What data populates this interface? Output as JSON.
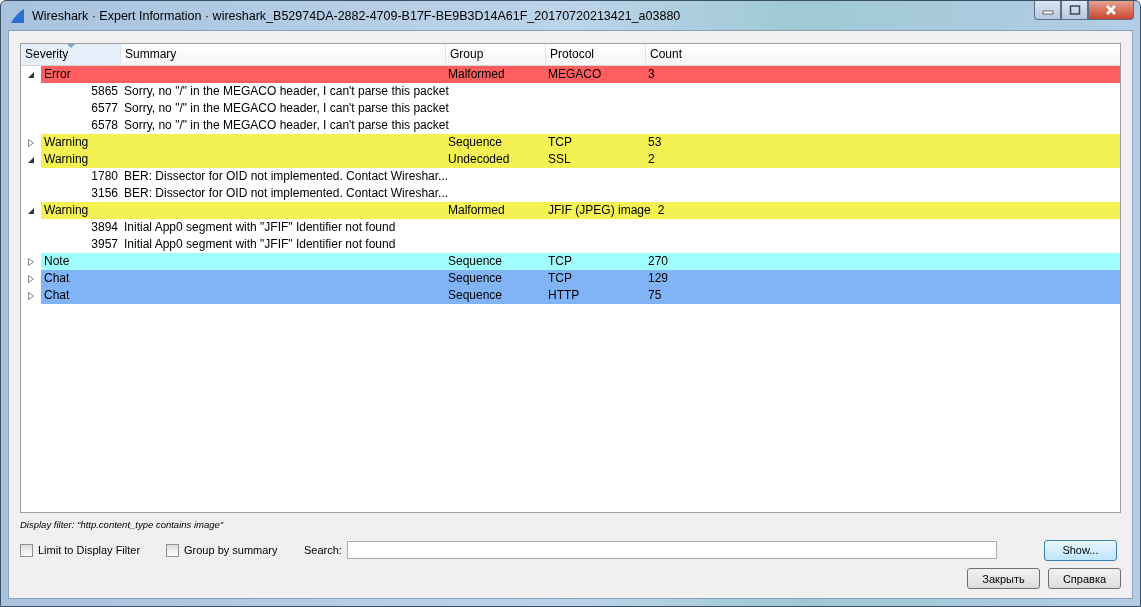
{
  "window": {
    "title": "Wireshark · Expert Information · wireshark_B52974DA-2882-4709-B17F-BE9B3D14A61F_20170720213421_a03880"
  },
  "table": {
    "columns": [
      {
        "label": "Severity",
        "sorted": true
      },
      {
        "label": "Summary",
        "sorted": false
      },
      {
        "label": "Group",
        "sorted": false
      },
      {
        "label": "Protocol",
        "sorted": false
      },
      {
        "label": "Count",
        "sorted": false
      }
    ],
    "rows": [
      {
        "severity": "Error",
        "group": "Malformed",
        "protocol": "MEGACO",
        "count": "3",
        "color": "#ff5e5e",
        "expanded": true,
        "children": [
          {
            "packet": "5865",
            "summary": "Sorry, no \"/\" in the MEGACO header, I can't parse this packet"
          },
          {
            "packet": "6577",
            "summary": "Sorry, no \"/\" in the MEGACO header, I can't parse this packet"
          },
          {
            "packet": "6578",
            "summary": "Sorry, no \"/\" in the MEGACO header, I can't parse this packet"
          }
        ]
      },
      {
        "severity": "Warning",
        "group": "Sequence",
        "protocol": "TCP",
        "count": "53",
        "color": "#f4f152",
        "expanded": false
      },
      {
        "severity": "Warning",
        "group": "Undecoded",
        "protocol": "SSL",
        "count": "2",
        "color": "#f4f152",
        "expanded": true,
        "children": [
          {
            "packet": "1780",
            "summary": "BER: Dissector for OID not implemented. Contact Wireshar..."
          },
          {
            "packet": "3156",
            "summary": "BER: Dissector for OID not implemented. Contact Wireshar..."
          }
        ]
      },
      {
        "severity": "Warning",
        "group": "Malformed",
        "protocol": "JFIF (JPEG) image",
        "count": "2",
        "color": "#f4f152",
        "expanded": true,
        "children": [
          {
            "packet": "3894",
            "summary": "Initial App0 segment with \"JFIF\" Identifier not found"
          },
          {
            "packet": "3957",
            "summary": "Initial App0 segment with \"JFIF\" Identifier not found"
          }
        ]
      },
      {
        "severity": "Note",
        "group": "Sequence",
        "protocol": "TCP",
        "count": "270",
        "color": "#a0fffe",
        "expanded": false
      },
      {
        "severity": "Chat",
        "group": "Sequence",
        "protocol": "TCP",
        "count": "129",
        "color": "#80b4f6",
        "expanded": false
      },
      {
        "severity": "Chat",
        "group": "Sequence",
        "protocol": "HTTP",
        "count": "75",
        "color": "#80b4f6",
        "expanded": false
      }
    ]
  },
  "display_filter": "Display filter: \"http.content_type contains image\"",
  "options": [
    {
      "label": "Limit to Display Filter",
      "checked": false
    },
    {
      "label": "Group by summary",
      "checked": false
    }
  ],
  "search": {
    "label": "Search:"
  },
  "buttons": [
    {
      "label": "Show...",
      "default": true
    },
    {
      "label": "Закрыть",
      "default": false
    },
    {
      "label": "Справка",
      "default": false
    }
  ]
}
